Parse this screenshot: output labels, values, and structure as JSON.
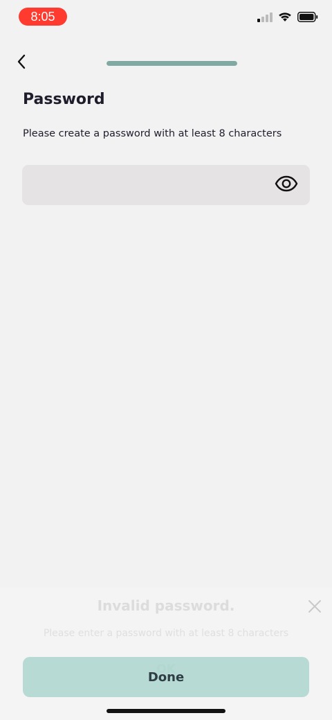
{
  "status_bar": {
    "time": "8:05",
    "icons": [
      "cellular-signal-icon",
      "wifi-icon",
      "battery-icon"
    ]
  },
  "nav": {
    "back_icon": "chevron-left-icon",
    "progress": 1.0
  },
  "page": {
    "title": "Password",
    "subtitle": "Please create a password with at least 8 characters"
  },
  "password_field": {
    "value": "",
    "placeholder": "",
    "toggle_icon": "eye-icon"
  },
  "toast": {
    "title": "Invalid password.",
    "message": "Please enter a password with at least 8 characters",
    "ok_label": "OK",
    "close_icon": "close-icon"
  },
  "footer": {
    "done_label": "Done"
  },
  "colors": {
    "status_pill": "#ff3b30",
    "progress": "#7fa9a2",
    "button": "#b2d8d1",
    "text": "#1f1d2b"
  }
}
